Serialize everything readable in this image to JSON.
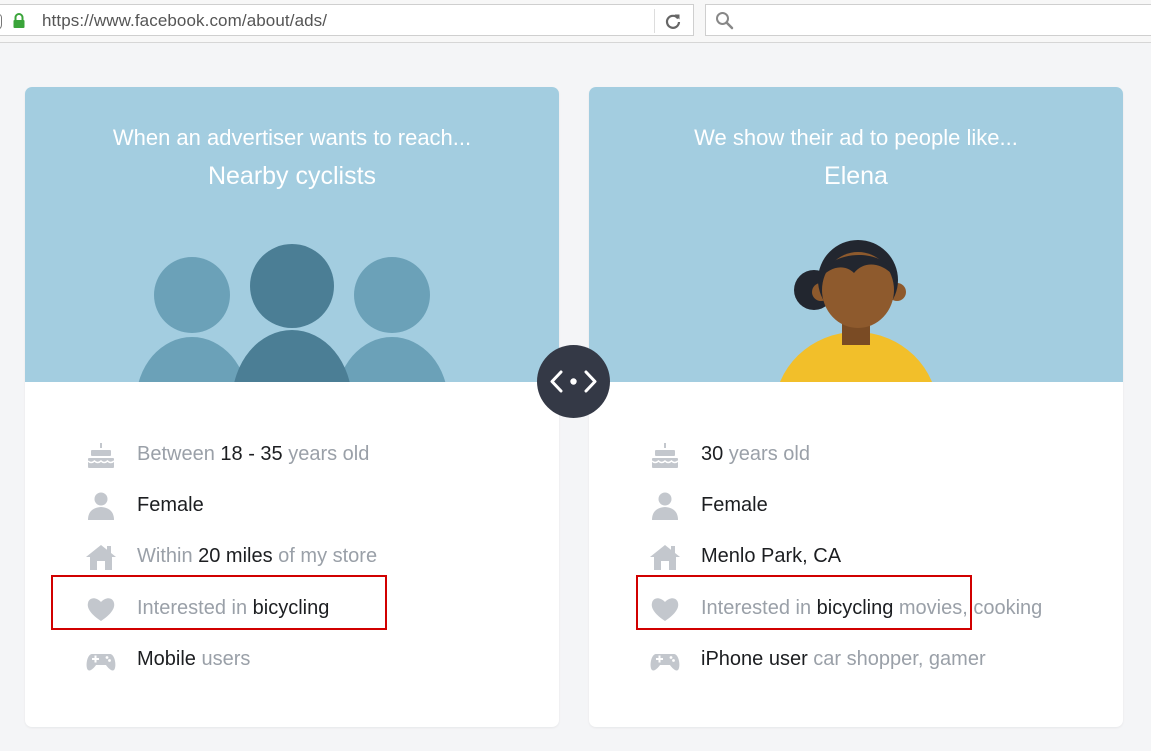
{
  "browser": {
    "url": "https://www.facebook.com/about/ads/",
    "search_placeholder": ""
  },
  "colors": {
    "header_bg": "#a3cde0",
    "toggle_bg": "#343946",
    "highlight": "#d10000",
    "muted_text": "#9aa0a8",
    "strong_text": "#1c1e21"
  },
  "left_card": {
    "subtitle": "When an advertiser wants to reach...",
    "title": "Nearby cyclists",
    "illustration": "three-people-silhouettes",
    "attributes": [
      {
        "icon": "birthday-cake-icon",
        "parts": [
          "Between ",
          "18 - 35",
          " years old"
        ]
      },
      {
        "icon": "person-icon",
        "parts": [
          "",
          "Female",
          ""
        ]
      },
      {
        "icon": "house-icon",
        "parts": [
          "Within ",
          "20 miles",
          " of my store"
        ]
      },
      {
        "icon": "heart-icon",
        "parts": [
          "Interested in ",
          "bicycling",
          ""
        ]
      },
      {
        "icon": "gamepad-icon",
        "parts": [
          "",
          "Mobile",
          " users"
        ]
      }
    ]
  },
  "right_card": {
    "subtitle": "We show their ad to people like...",
    "title": "Elena",
    "illustration": "woman-avatar",
    "attributes": [
      {
        "icon": "birthday-cake-icon",
        "parts": [
          "",
          "30",
          " years old"
        ]
      },
      {
        "icon": "person-icon",
        "parts": [
          "",
          "Female",
          ""
        ]
      },
      {
        "icon": "house-icon",
        "parts": [
          "",
          "Menlo Park, CA",
          ""
        ]
      },
      {
        "icon": "heart-icon",
        "parts": [
          "Interested in ",
          "bicycling",
          " movies, cooking"
        ]
      },
      {
        "icon": "gamepad-icon",
        "parts": [
          "",
          "iPhone user",
          " car shopper, gamer"
        ]
      }
    ]
  },
  "toggle": {
    "icon": "code-arrows-icon"
  }
}
